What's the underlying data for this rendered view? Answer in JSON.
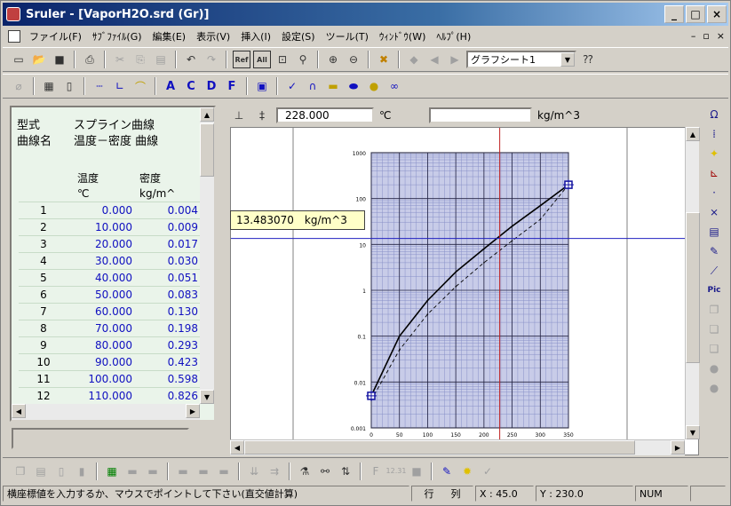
{
  "window": {
    "title": "Sruler - [VaporH2O.srd (Gr)]",
    "buttons": [
      "_",
      "□",
      "×"
    ]
  },
  "menu": {
    "items": [
      "ファイル(F)",
      "ｻﾌﾞﾌｧｲﾙ(G)",
      "編集(E)",
      "表示(V)",
      "挿入(I)",
      "設定(S)",
      "ツール(T)",
      "ｳｨﾝﾄﾞｳ(W)",
      "ﾍﾙﾌﾟ(H)"
    ],
    "mdi_controls": [
      "–",
      "▫",
      "×"
    ]
  },
  "toolbar1": {
    "sheet_select": "グラフシート1",
    "icons": [
      "new-icon",
      "open-icon",
      "save-icon",
      "print-icon",
      "cut-icon",
      "copy-icon",
      "paste-icon",
      "undo-icon",
      "redo-icon",
      "ref-icon",
      "all-icon",
      "fit-icon",
      "marker-icon",
      "zoom-in-icon",
      "zoom-out-icon",
      "delete-icon",
      "layer-icon",
      "prev-icon",
      "next-icon",
      "help-icon"
    ]
  },
  "toolbar2": {
    "letters": [
      "A",
      "C",
      "D",
      "F"
    ]
  },
  "left_panel": {
    "type_label": "型式",
    "type_value": "スプライン曲線",
    "curve_label": "曲線名",
    "curve_value": "温度－密度 曲線",
    "columns": [
      {
        "name": "温度",
        "unit": "℃"
      },
      {
        "name": "密度",
        "unit": "kg/m^"
      }
    ],
    "rows": [
      {
        "n": "1",
        "t": "0.000",
        "d": "0.004"
      },
      {
        "n": "2",
        "t": "10.000",
        "d": "0.009"
      },
      {
        "n": "3",
        "t": "20.000",
        "d": "0.017"
      },
      {
        "n": "4",
        "t": "30.000",
        "d": "0.030"
      },
      {
        "n": "5",
        "t": "40.000",
        "d": "0.051"
      },
      {
        "n": "6",
        "t": "50.000",
        "d": "0.083"
      },
      {
        "n": "7",
        "t": "60.000",
        "d": "0.130"
      },
      {
        "n": "8",
        "t": "70.000",
        "d": "0.198"
      },
      {
        "n": "9",
        "t": "80.000",
        "d": "0.293"
      },
      {
        "n": "10",
        "t": "90.000",
        "d": "0.423"
      },
      {
        "n": "11",
        "t": "100.000",
        "d": "0.598"
      },
      {
        "n": "12",
        "t": "110.000",
        "d": "0.826"
      }
    ]
  },
  "chart_top": {
    "x_value": "228.000",
    "x_unit": "℃",
    "y_unit": "kg/m^3"
  },
  "readout": {
    "value": "13.483070",
    "unit": "kg/m^3"
  },
  "chart_data": {
    "type": "line",
    "x": [
      0,
      50,
      100,
      150,
      200,
      250,
      300,
      350
    ],
    "xlim": [
      0,
      350
    ],
    "ylim_log": [
      0.001,
      1000
    ],
    "y_ticks": [
      "1000",
      "100",
      "10",
      "1",
      "0.1",
      "0.01",
      "0.001"
    ],
    "x_ticks": [
      "0",
      "50",
      "100",
      "150",
      "200",
      "250",
      "300",
      "350"
    ],
    "y_scale": "log",
    "series": [
      {
        "values": [
          0.005,
          0.1,
          0.6,
          2.5,
          8,
          25,
          70,
          200
        ]
      },
      {
        "values": [
          0.004,
          0.05,
          0.3,
          1.2,
          4,
          12,
          35,
          200
        ]
      }
    ],
    "cursor_x": 228,
    "cursor_y": 13.48307
  },
  "statusbar": {
    "message": "横座標値を入力するか、マウスでポイントして下さい(直交値計算)",
    "row_label": "行",
    "col_label": "列",
    "x_label": "X : 45.0",
    "y_label": "Y : 230.0",
    "num": "NUM"
  }
}
